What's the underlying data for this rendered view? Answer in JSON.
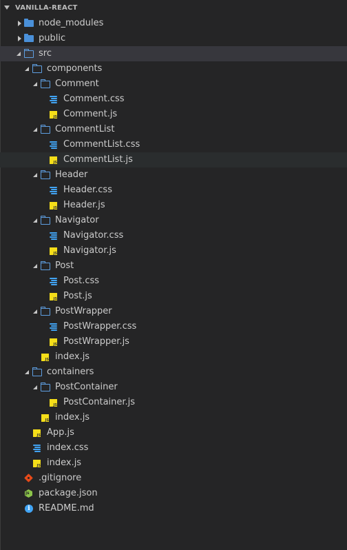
{
  "explorer": {
    "title": "VANILLA-REACT"
  },
  "tree": [
    {
      "label": "node_modules",
      "type": "folder",
      "state": "collapsed",
      "depth": 0
    },
    {
      "label": "public",
      "type": "folder",
      "state": "collapsed",
      "depth": 0
    },
    {
      "label": "src",
      "type": "folder",
      "state": "expanded",
      "depth": 0,
      "highlight": "selected"
    },
    {
      "label": "components",
      "type": "folder",
      "state": "expanded",
      "depth": 1
    },
    {
      "label": "Comment",
      "type": "folder",
      "state": "expanded",
      "depth": 2
    },
    {
      "label": "Comment.css",
      "type": "css",
      "depth": 3
    },
    {
      "label": "Comment.js",
      "type": "js",
      "depth": 3
    },
    {
      "label": "CommentList",
      "type": "folder",
      "state": "expanded",
      "depth": 2
    },
    {
      "label": "CommentList.css",
      "type": "css",
      "depth": 3
    },
    {
      "label": "CommentList.js",
      "type": "js",
      "depth": 3,
      "highlight": "hovered"
    },
    {
      "label": "Header",
      "type": "folder",
      "state": "expanded",
      "depth": 2
    },
    {
      "label": "Header.css",
      "type": "css",
      "depth": 3
    },
    {
      "label": "Header.js",
      "type": "js",
      "depth": 3
    },
    {
      "label": "Navigator",
      "type": "folder",
      "state": "expanded",
      "depth": 2
    },
    {
      "label": "Navigator.css",
      "type": "css",
      "depth": 3
    },
    {
      "label": "Navigator.js",
      "type": "js",
      "depth": 3
    },
    {
      "label": "Post",
      "type": "folder",
      "state": "expanded",
      "depth": 2
    },
    {
      "label": "Post.css",
      "type": "css",
      "depth": 3
    },
    {
      "label": "Post.js",
      "type": "js",
      "depth": 3
    },
    {
      "label": "PostWrapper",
      "type": "folder",
      "state": "expanded",
      "depth": 2
    },
    {
      "label": "PostWrapper.css",
      "type": "css",
      "depth": 3
    },
    {
      "label": "PostWrapper.js",
      "type": "js",
      "depth": 3
    },
    {
      "label": "index.js",
      "type": "js",
      "depth": 2
    },
    {
      "label": "containers",
      "type": "folder",
      "state": "expanded",
      "depth": 1
    },
    {
      "label": "PostContainer",
      "type": "folder",
      "state": "expanded",
      "depth": 2
    },
    {
      "label": "PostContainer.js",
      "type": "js",
      "depth": 3
    },
    {
      "label": "index.js",
      "type": "js",
      "depth": 2
    },
    {
      "label": "App.js",
      "type": "js",
      "depth": 1
    },
    {
      "label": "index.css",
      "type": "css",
      "depth": 1
    },
    {
      "label": "index.js",
      "type": "js",
      "depth": 1
    },
    {
      "label": ".gitignore",
      "type": "git",
      "depth": 0
    },
    {
      "label": "package.json",
      "type": "json",
      "depth": 0
    },
    {
      "label": "README.md",
      "type": "info",
      "depth": 0
    }
  ],
  "colors": {
    "background": "#252526",
    "text": "#cccccc",
    "selected_row": "#37373d",
    "hovered_row": "#2a2d2e",
    "folder": "#4a90d9",
    "js": "#f5de19",
    "css": "#42a5f5",
    "git": "#e64a19",
    "json": "#8bc34a",
    "info": "#42a5f5"
  }
}
